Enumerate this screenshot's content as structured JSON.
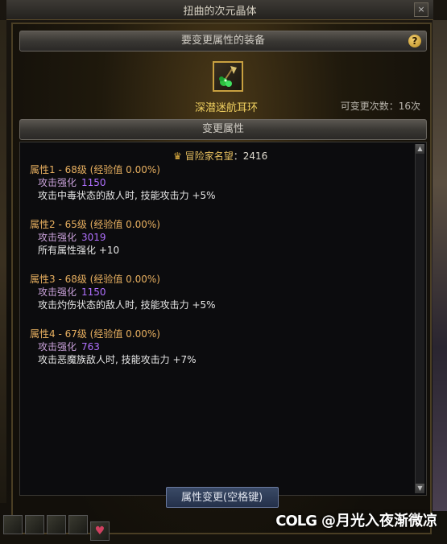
{
  "window": {
    "title": "扭曲的次元晶体",
    "close_symbol": "×"
  },
  "equip_section": {
    "header": "要变更属性的装备",
    "help_symbol": "?",
    "item_name": "深潜迷航耳环",
    "change_count": "可变更次数：16次"
  },
  "attr_section": {
    "header": "变更属性"
  },
  "fame": {
    "label": "冒险家名望",
    "value": "：2416"
  },
  "attributes": [
    {
      "title": "属性1 - 68级 (经验值 0.00%)",
      "stat": "攻击强化",
      "value": "1150",
      "effect": "攻击中毒状态的敌人时, 技能攻击力 +5%"
    },
    {
      "title": "属性2 - 65级 (经验值 0.00%)",
      "stat": "攻击强化",
      "value": "3019",
      "effect": "所有属性强化 +10"
    },
    {
      "title": "属性3 - 68级 (经验值 0.00%)",
      "stat": "攻击强化",
      "value": "1150",
      "effect": "攻击灼伤状态的敌人时, 技能攻击力 +5%"
    },
    {
      "title": "属性4 - 67级 (经验值 0.00%)",
      "stat": "攻击强化",
      "value": "763",
      "effect": "攻击恶魔族敌人时, 技能攻击力 +7%"
    }
  ],
  "bottom": {
    "change_button": "属性变更(空格键)"
  },
  "watermark": {
    "logo": "COLG",
    "text": "@月光入夜渐微凉"
  },
  "colors": {
    "item_name": "#f0d060",
    "attr_title": "#e8b060",
    "stat_value": "#b070ff"
  }
}
